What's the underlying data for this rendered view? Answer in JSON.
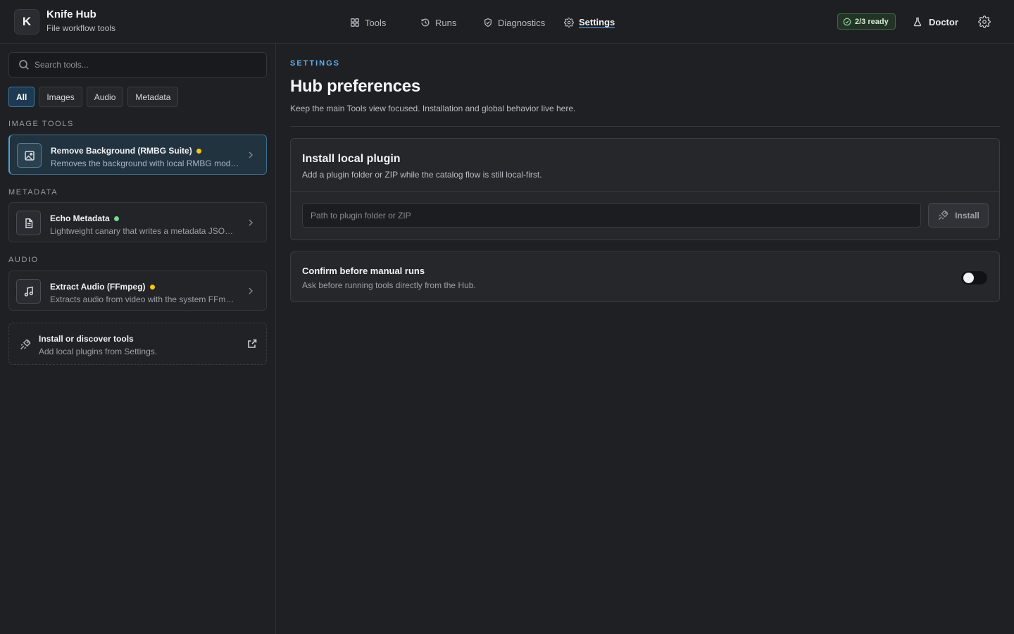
{
  "app": {
    "logo_letter": "K",
    "title": "Knife Hub",
    "subtitle": "File workflow tools"
  },
  "nav": {
    "items": [
      {
        "label": "Tools",
        "icon": "grid-icon",
        "active": false
      },
      {
        "label": "Runs",
        "icon": "history-icon",
        "active": false
      },
      {
        "label": "Diagnostics",
        "icon": "shield-check-icon",
        "active": false
      },
      {
        "label": "Settings",
        "icon": "gear-icon",
        "active": true
      }
    ]
  },
  "header_right": {
    "ready_badge": "2/3 ready",
    "doctor_label": "Doctor"
  },
  "sidebar": {
    "search_placeholder": "Search tools...",
    "filters": [
      {
        "label": "All",
        "active": true
      },
      {
        "label": "Images",
        "active": false
      },
      {
        "label": "Audio",
        "active": false
      },
      {
        "label": "Metadata",
        "active": false
      }
    ],
    "sections": [
      {
        "label": "IMAGE TOOLS",
        "tools": [
          {
            "name": "Remove Background (RMBG Suite)",
            "description": "Removes the background with local RMBG models",
            "status_color": "#f5c518",
            "icon": "image-icon",
            "selected": true
          }
        ]
      },
      {
        "label": "METADATA",
        "tools": [
          {
            "name": "Echo Metadata",
            "description": "Lightweight canary that writes a metadata JSON file",
            "status_color": "#7bd88f",
            "icon": "document-icon",
            "selected": false
          }
        ]
      },
      {
        "label": "AUDIO",
        "tools": [
          {
            "name": "Extract Audio (FFmpeg)",
            "description": "Extracts audio from video with the system FFmpeg",
            "status_color": "#f5c518",
            "icon": "music-icon",
            "selected": false
          }
        ]
      }
    ],
    "discover": {
      "title": "Install or discover tools",
      "subtitle": "Add local plugins from Settings."
    }
  },
  "main": {
    "eyebrow": "SETTINGS",
    "title": "Hub preferences",
    "subtitle": "Keep the main Tools view focused. Installation and global behavior live here.",
    "install_card": {
      "title": "Install local plugin",
      "subtitle": "Add a plugin folder or ZIP while the catalog flow is still local-first.",
      "input_placeholder": "Path to plugin folder or ZIP",
      "input_value": "",
      "button_label": "Install"
    },
    "confirm_card": {
      "title": "Confirm before manual runs",
      "subtitle": "Ask before running tools directly from the Hub.",
      "toggle_on": false
    }
  },
  "colors": {
    "accent": "#5fb0f0",
    "ready_green": "#8fd19a",
    "status_yellow": "#f5c518",
    "status_green": "#7bd88f"
  }
}
